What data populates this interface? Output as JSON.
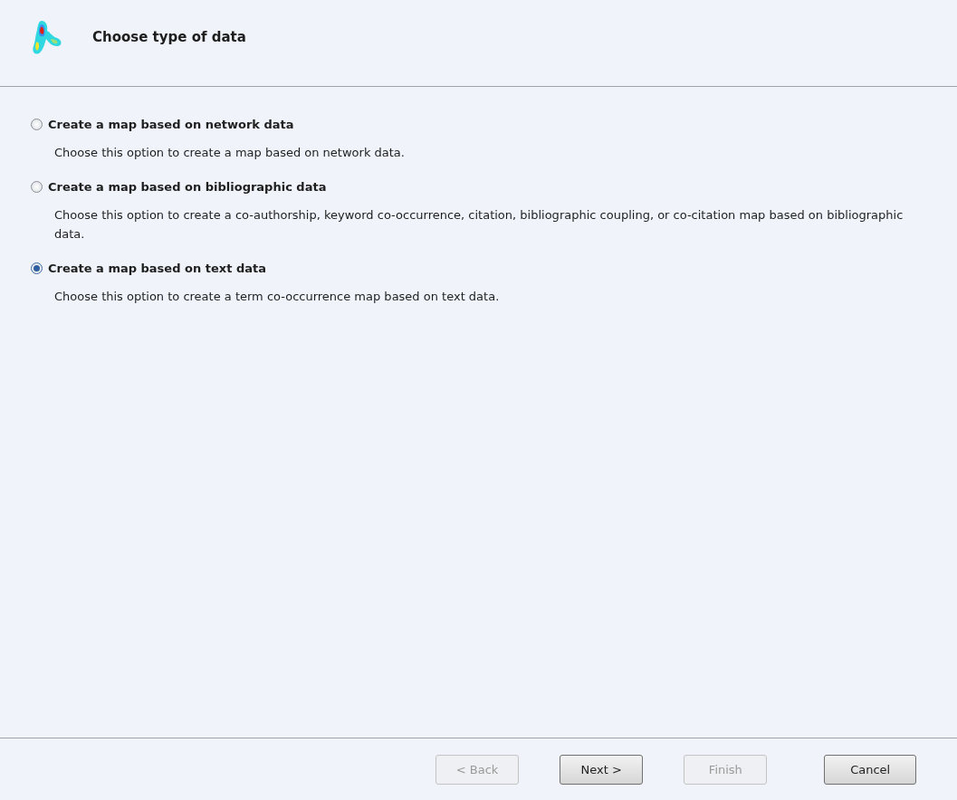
{
  "header": {
    "title": "Choose type of data"
  },
  "options": [
    {
      "label": "Create a map based on network data",
      "description": "Choose this option to create a map based on network data.",
      "selected": false
    },
    {
      "label": "Create a map based on bibliographic data",
      "description": "Choose this option to create a co-authorship, keyword co-occurrence, citation, bibliographic coupling, or co-citation map based on bibliographic data.",
      "selected": false
    },
    {
      "label": "Create a map based on text data",
      "description": "Choose this option to create a term co-occurrence map based on text data.",
      "selected": true
    }
  ],
  "buttons": [
    {
      "label": "< Back",
      "disabled": true
    },
    {
      "label": "Next >",
      "disabled": false
    },
    {
      "label": "Finish",
      "disabled": true
    },
    {
      "label": "Cancel",
      "disabled": false
    }
  ]
}
